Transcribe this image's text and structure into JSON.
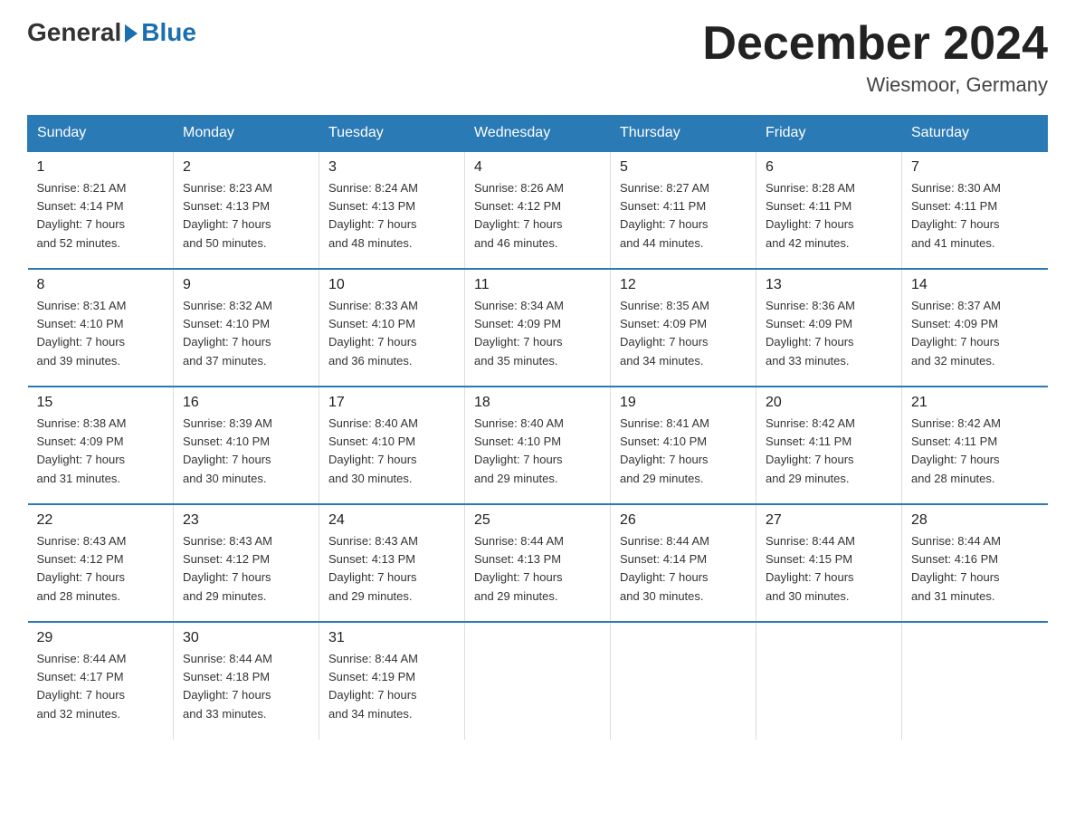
{
  "logo": {
    "general": "General",
    "blue": "Blue"
  },
  "title": "December 2024",
  "location": "Wiesmoor, Germany",
  "days_of_week": [
    "Sunday",
    "Monday",
    "Tuesday",
    "Wednesday",
    "Thursday",
    "Friday",
    "Saturday"
  ],
  "weeks": [
    [
      {
        "day": "1",
        "sunrise": "8:21 AM",
        "sunset": "4:14 PM",
        "daylight": "7 hours and 52 minutes."
      },
      {
        "day": "2",
        "sunrise": "8:23 AM",
        "sunset": "4:13 PM",
        "daylight": "7 hours and 50 minutes."
      },
      {
        "day": "3",
        "sunrise": "8:24 AM",
        "sunset": "4:13 PM",
        "daylight": "7 hours and 48 minutes."
      },
      {
        "day": "4",
        "sunrise": "8:26 AM",
        "sunset": "4:12 PM",
        "daylight": "7 hours and 46 minutes."
      },
      {
        "day": "5",
        "sunrise": "8:27 AM",
        "sunset": "4:11 PM",
        "daylight": "7 hours and 44 minutes."
      },
      {
        "day": "6",
        "sunrise": "8:28 AM",
        "sunset": "4:11 PM",
        "daylight": "7 hours and 42 minutes."
      },
      {
        "day": "7",
        "sunrise": "8:30 AM",
        "sunset": "4:11 PM",
        "daylight": "7 hours and 41 minutes."
      }
    ],
    [
      {
        "day": "8",
        "sunrise": "8:31 AM",
        "sunset": "4:10 PM",
        "daylight": "7 hours and 39 minutes."
      },
      {
        "day": "9",
        "sunrise": "8:32 AM",
        "sunset": "4:10 PM",
        "daylight": "7 hours and 37 minutes."
      },
      {
        "day": "10",
        "sunrise": "8:33 AM",
        "sunset": "4:10 PM",
        "daylight": "7 hours and 36 minutes."
      },
      {
        "day": "11",
        "sunrise": "8:34 AM",
        "sunset": "4:09 PM",
        "daylight": "7 hours and 35 minutes."
      },
      {
        "day": "12",
        "sunrise": "8:35 AM",
        "sunset": "4:09 PM",
        "daylight": "7 hours and 34 minutes."
      },
      {
        "day": "13",
        "sunrise": "8:36 AM",
        "sunset": "4:09 PM",
        "daylight": "7 hours and 33 minutes."
      },
      {
        "day": "14",
        "sunrise": "8:37 AM",
        "sunset": "4:09 PM",
        "daylight": "7 hours and 32 minutes."
      }
    ],
    [
      {
        "day": "15",
        "sunrise": "8:38 AM",
        "sunset": "4:09 PM",
        "daylight": "7 hours and 31 minutes."
      },
      {
        "day": "16",
        "sunrise": "8:39 AM",
        "sunset": "4:10 PM",
        "daylight": "7 hours and 30 minutes."
      },
      {
        "day": "17",
        "sunrise": "8:40 AM",
        "sunset": "4:10 PM",
        "daylight": "7 hours and 30 minutes."
      },
      {
        "day": "18",
        "sunrise": "8:40 AM",
        "sunset": "4:10 PM",
        "daylight": "7 hours and 29 minutes."
      },
      {
        "day": "19",
        "sunrise": "8:41 AM",
        "sunset": "4:10 PM",
        "daylight": "7 hours and 29 minutes."
      },
      {
        "day": "20",
        "sunrise": "8:42 AM",
        "sunset": "4:11 PM",
        "daylight": "7 hours and 29 minutes."
      },
      {
        "day": "21",
        "sunrise": "8:42 AM",
        "sunset": "4:11 PM",
        "daylight": "7 hours and 28 minutes."
      }
    ],
    [
      {
        "day": "22",
        "sunrise": "8:43 AM",
        "sunset": "4:12 PM",
        "daylight": "7 hours and 28 minutes."
      },
      {
        "day": "23",
        "sunrise": "8:43 AM",
        "sunset": "4:12 PM",
        "daylight": "7 hours and 29 minutes."
      },
      {
        "day": "24",
        "sunrise": "8:43 AM",
        "sunset": "4:13 PM",
        "daylight": "7 hours and 29 minutes."
      },
      {
        "day": "25",
        "sunrise": "8:44 AM",
        "sunset": "4:13 PM",
        "daylight": "7 hours and 29 minutes."
      },
      {
        "day": "26",
        "sunrise": "8:44 AM",
        "sunset": "4:14 PM",
        "daylight": "7 hours and 30 minutes."
      },
      {
        "day": "27",
        "sunrise": "8:44 AM",
        "sunset": "4:15 PM",
        "daylight": "7 hours and 30 minutes."
      },
      {
        "day": "28",
        "sunrise": "8:44 AM",
        "sunset": "4:16 PM",
        "daylight": "7 hours and 31 minutes."
      }
    ],
    [
      {
        "day": "29",
        "sunrise": "8:44 AM",
        "sunset": "4:17 PM",
        "daylight": "7 hours and 32 minutes."
      },
      {
        "day": "30",
        "sunrise": "8:44 AM",
        "sunset": "4:18 PM",
        "daylight": "7 hours and 33 minutes."
      },
      {
        "day": "31",
        "sunrise": "8:44 AM",
        "sunset": "4:19 PM",
        "daylight": "7 hours and 34 minutes."
      },
      null,
      null,
      null,
      null
    ]
  ],
  "labels": {
    "sunrise": "Sunrise:",
    "sunset": "Sunset:",
    "daylight": "Daylight:"
  }
}
